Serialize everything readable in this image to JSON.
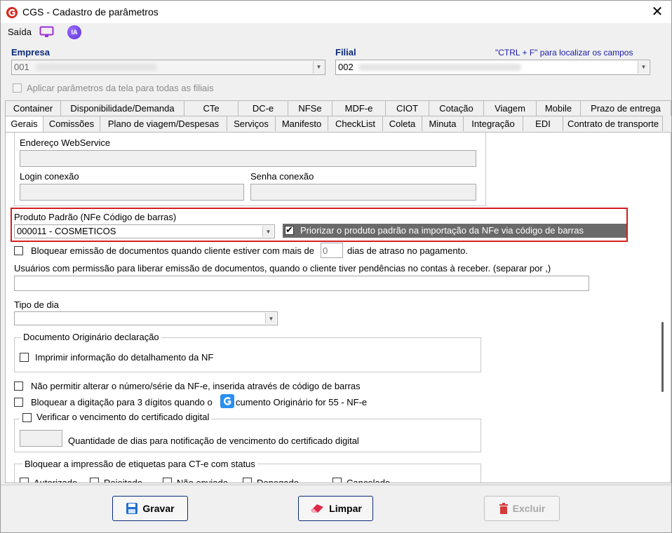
{
  "window": {
    "title": "CGS - Cadastro de parâmetros",
    "close": "✕"
  },
  "menu": {
    "saida": "Saída",
    "ia": "IA"
  },
  "empresa": {
    "label": "Empresa",
    "value": "001"
  },
  "filial": {
    "label": "Filial",
    "value": "002"
  },
  "hint": "\"CTRL + F\" para localizar os campos",
  "apply_all": "Aplicar parâmetros da tela para todas as filiais",
  "tabs_row1": [
    "Container",
    "Disponibilidade/Demanda",
    "CTe",
    "DC-e",
    "NFSe",
    "MDF-e",
    "CIOT",
    "Cotação",
    "Viagem",
    "Mobile",
    "Prazo de entrega"
  ],
  "tabs_row2": [
    "Gerais",
    "Comissões",
    "Plano de viagem/Despesas",
    "Serviços",
    "Manifesto",
    "CheckList",
    "Coleta",
    "Minuta",
    "Integração",
    "EDI",
    "Contrato de transporte"
  ],
  "fields": {
    "endereco_ws": "Endereço WebService",
    "login": "Login conexão",
    "senha": "Senha conexão"
  },
  "produto": {
    "label": "Produto Padrão (NFe Código de barras)",
    "value": "000011 - COSMETICOS",
    "priorizar": "Priorizar o produto padrão na importação da NFe via código de barras"
  },
  "bloquear": {
    "prefix": "Bloquear emissão de documentos quando cliente estiver com mais de",
    "days": "0",
    "suffix": "dias de atraso no pagamento."
  },
  "usuarios_label": "Usuários com permissão para liberar emissão de documentos, quando o cliente tiver pendências no contas à receber. (separar por ,)",
  "tipo_dia": "Tipo de dia",
  "doc_orig": {
    "title": "Documento Originário declaração",
    "imprimir": "Imprimir informação do detalhamento da NF"
  },
  "nao_permitir": "Não permitir alterar o número/série da NF-e, inserida através de código de barras",
  "bloquear_digitacao": {
    "before": "Bloquear a digitação para 3 dígitos quando o ",
    "after": "cumento Originário for 55 - NF-e"
  },
  "certificado": {
    "title": "Verificar o vencimento do certificado digital",
    "qtd": "Quantidade de dias para notificação de vencimento do certificado digital"
  },
  "etiquetas": {
    "title": "Bloquear a impressão de etiquetas para CT-e com status",
    "status": [
      "Autorizado",
      "Rejeitado",
      "Não enviado",
      "Denegado",
      "Cancelado"
    ]
  },
  "buttons": {
    "gravar": "Gravar",
    "limpar": "Limpar",
    "excluir": "Excluir"
  },
  "colors": {
    "accent": "#0a2a7a",
    "highlight": "#d42020"
  }
}
